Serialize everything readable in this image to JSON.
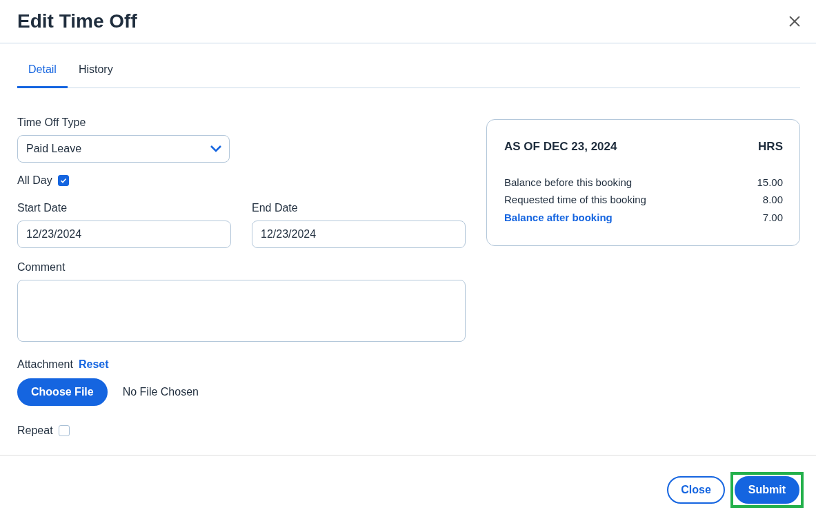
{
  "dialog": {
    "title": "Edit Time Off"
  },
  "tabs": [
    {
      "label": "Detail",
      "selected": true
    },
    {
      "label": "History",
      "selected": false
    }
  ],
  "form": {
    "time_off_type": {
      "label": "Time Off Type",
      "value": "Paid Leave"
    },
    "all_day": {
      "label": "All Day",
      "checked": true
    },
    "start_date": {
      "label": "Start Date",
      "value": "12/23/2024"
    },
    "end_date": {
      "label": "End Date",
      "value": "12/23/2024"
    },
    "comment": {
      "label": "Comment"
    },
    "attachment": {
      "label": "Attachment",
      "reset": "Reset",
      "button": "Choose File",
      "status": "No File Chosen"
    },
    "repeat": {
      "label": "Repeat",
      "checked": false
    }
  },
  "balance": {
    "heading": "AS OF DEC 23, 2024",
    "unit": "HRS",
    "rows": [
      {
        "label": "Balance before this booking",
        "value": "15.00",
        "kind": "plain"
      },
      {
        "label": "Requested time of this booking",
        "value": "8.00",
        "kind": "plain"
      },
      {
        "label": "Balance after booking",
        "value": "7.00",
        "kind": "link"
      }
    ]
  },
  "footer": {
    "buttons": [
      {
        "label": "Close",
        "kind": "outline",
        "highlighted": false
      },
      {
        "label": "Submit",
        "kind": "primary",
        "highlighted": true
      }
    ]
  }
}
